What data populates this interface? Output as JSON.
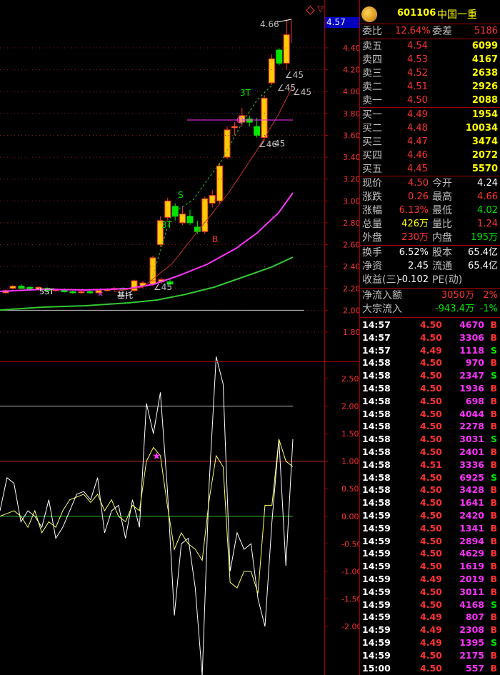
{
  "header": {
    "code": "601106",
    "name": "中国一重"
  },
  "price_tag": "4.57",
  "top_note": "4.66",
  "main_axis": {
    "labels": [
      "4.40",
      "4.20",
      "4.00",
      "3.80",
      "3.60",
      "3.40",
      "3.20",
      "3.00",
      "2.80",
      "2.60",
      "2.40",
      "2.20",
      "2.00",
      "1.80"
    ],
    "values": [
      4.4,
      4.2,
      4.0,
      3.8,
      3.6,
      3.4,
      3.2,
      3.0,
      2.8,
      2.6,
      2.4,
      2.2,
      2.0,
      1.8
    ]
  },
  "sub_axis": {
    "labels": [
      "2.50",
      "2.00",
      "1.50",
      "1.00",
      "0.50",
      "0.00",
      "-0.50",
      "-1.00",
      "-1.50",
      "-2.00"
    ],
    "values": [
      2.5,
      2.0,
      1.5,
      1.0,
      0.5,
      0.0,
      -0.5,
      -1.0,
      -1.5,
      -2.0
    ]
  },
  "annotations": {
    "a45_1": "∠45",
    "a45_2": "∠45",
    "a45_3": "∠45",
    "a46": "∠46",
    "a45_4": "45",
    "a45_5": "∠45",
    "t3_top": "3T",
    "t3_mid": "3T",
    "s_mid": "S",
    "b_mid": "B",
    "t5": "5ST",
    "jichu": "基托",
    "small_x": "×"
  },
  "quote": {
    "weibi_label": "委比",
    "weibi": "12.64%",
    "weicha_label": "委差",
    "weicha": "5186",
    "sells": [
      {
        "label": "卖五",
        "price": "4.54",
        "vol": "6099"
      },
      {
        "label": "卖四",
        "price": "4.53",
        "vol": "4167"
      },
      {
        "label": "卖三",
        "price": "4.52",
        "vol": "2638"
      },
      {
        "label": "卖二",
        "price": "4.51",
        "vol": "2926"
      },
      {
        "label": "卖一",
        "price": "4.50",
        "vol": "2088"
      }
    ],
    "buys": [
      {
        "label": "买一",
        "price": "4.49",
        "vol": "1954"
      },
      {
        "label": "买二",
        "price": "4.48",
        "vol": "10034"
      },
      {
        "label": "买三",
        "price": "4.47",
        "vol": "3474"
      },
      {
        "label": "买四",
        "price": "4.46",
        "vol": "2072"
      },
      {
        "label": "买五",
        "price": "4.45",
        "vol": "5570"
      }
    ],
    "stats": [
      {
        "l1": "现价",
        "v1": "4.50",
        "c1": "red",
        "l2": "今开",
        "v2": "4.24",
        "c2": "white"
      },
      {
        "l1": "涨跌",
        "v1": "0.26",
        "c1": "red",
        "l2": "最高",
        "v2": "4.66",
        "c2": "red"
      },
      {
        "l1": "涨幅",
        "v1": "6.13%",
        "c1": "red",
        "l2": "最低",
        "v2": "4.02",
        "c2": "green"
      },
      {
        "l1": "总量",
        "v1": "426万",
        "c1": "yellow",
        "l2": "量比",
        "v2": "1.24",
        "c2": "red"
      },
      {
        "l1": "外盘",
        "v1": "230万",
        "c1": "red",
        "l2": "内盘",
        "v2": "195万",
        "c2": "green"
      }
    ],
    "stats2": [
      {
        "l1": "换手",
        "v1": "6.52%",
        "l2": "股本",
        "v2": "65.4亿"
      },
      {
        "l1": "净资",
        "v1": "2.45",
        "l2": "流通",
        "v2": "65.4亿"
      },
      {
        "l1": "收益(三)",
        "v1": "-0.102",
        "l2": "PE(动)",
        "v2": ""
      }
    ],
    "flow": [
      {
        "label": "净流入额",
        "value": "3050万",
        "pct": "2%",
        "c": "red"
      },
      {
        "label": "大宗流入",
        "value": "-943.4万",
        "pct": "-1%",
        "c": "green"
      }
    ]
  },
  "ticks": [
    {
      "t": "14:57",
      "p": "4.50",
      "v": "4670",
      "s": "B"
    },
    {
      "t": "14:57",
      "p": "4.50",
      "v": "3306",
      "s": "B"
    },
    {
      "t": "14:57",
      "p": "4.49",
      "v": "1118",
      "s": "S"
    },
    {
      "t": "14:58",
      "p": "4.50",
      "v": "970",
      "s": "B"
    },
    {
      "t": "14:58",
      "p": "4.50",
      "v": "2347",
      "s": "S"
    },
    {
      "t": "14:58",
      "p": "4.50",
      "v": "1936",
      "s": "B"
    },
    {
      "t": "14:58",
      "p": "4.50",
      "v": "698",
      "s": "B"
    },
    {
      "t": "14:58",
      "p": "4.50",
      "v": "4044",
      "s": "B"
    },
    {
      "t": "14:58",
      "p": "4.50",
      "v": "2278",
      "s": "B"
    },
    {
      "t": "14:58",
      "p": "4.50",
      "v": "3031",
      "s": "S"
    },
    {
      "t": "14:58",
      "p": "4.50",
      "v": "2401",
      "s": "B"
    },
    {
      "t": "14:58",
      "p": "4.51",
      "v": "3336",
      "s": "B"
    },
    {
      "t": "14:58",
      "p": "4.50",
      "v": "6925",
      "s": "S"
    },
    {
      "t": "14:58",
      "p": "4.50",
      "v": "3428",
      "s": "B"
    },
    {
      "t": "14:58",
      "p": "4.50",
      "v": "1641",
      "s": "B"
    },
    {
      "t": "14:59",
      "p": "4.50",
      "v": "2420",
      "s": "B"
    },
    {
      "t": "14:59",
      "p": "4.50",
      "v": "1341",
      "s": "B"
    },
    {
      "t": "14:59",
      "p": "4.50",
      "v": "2894",
      "s": "B"
    },
    {
      "t": "14:59",
      "p": "4.50",
      "v": "4629",
      "s": "B"
    },
    {
      "t": "14:59",
      "p": "4.50",
      "v": "1619",
      "s": "B"
    },
    {
      "t": "14:59",
      "p": "4.49",
      "v": "2019",
      "s": "B"
    },
    {
      "t": "14:59",
      "p": "4.50",
      "v": "3011",
      "s": "B"
    },
    {
      "t": "14:59",
      "p": "4.50",
      "v": "4168",
      "s": "S"
    },
    {
      "t": "14:59",
      "p": "4.49",
      "v": "807",
      "s": "B"
    },
    {
      "t": "14:59",
      "p": "4.49",
      "v": "2308",
      "s": "B"
    },
    {
      "t": "14:59",
      "p": "4.49",
      "v": "1395",
      "s": "S"
    },
    {
      "t": "14:59",
      "p": "4.50",
      "v": "2175",
      "s": "B"
    },
    {
      "t": "15:00",
      "p": "4.50",
      "v": "557",
      "s": "B"
    }
  ],
  "colors": {
    "up": "#ff3232",
    "down": "#00e600",
    "bull_fill": "#ffcc00",
    "ma_pink": "#ff32ff",
    "ma_green": "#32c832",
    "ma_red": "#c83232"
  }
}
